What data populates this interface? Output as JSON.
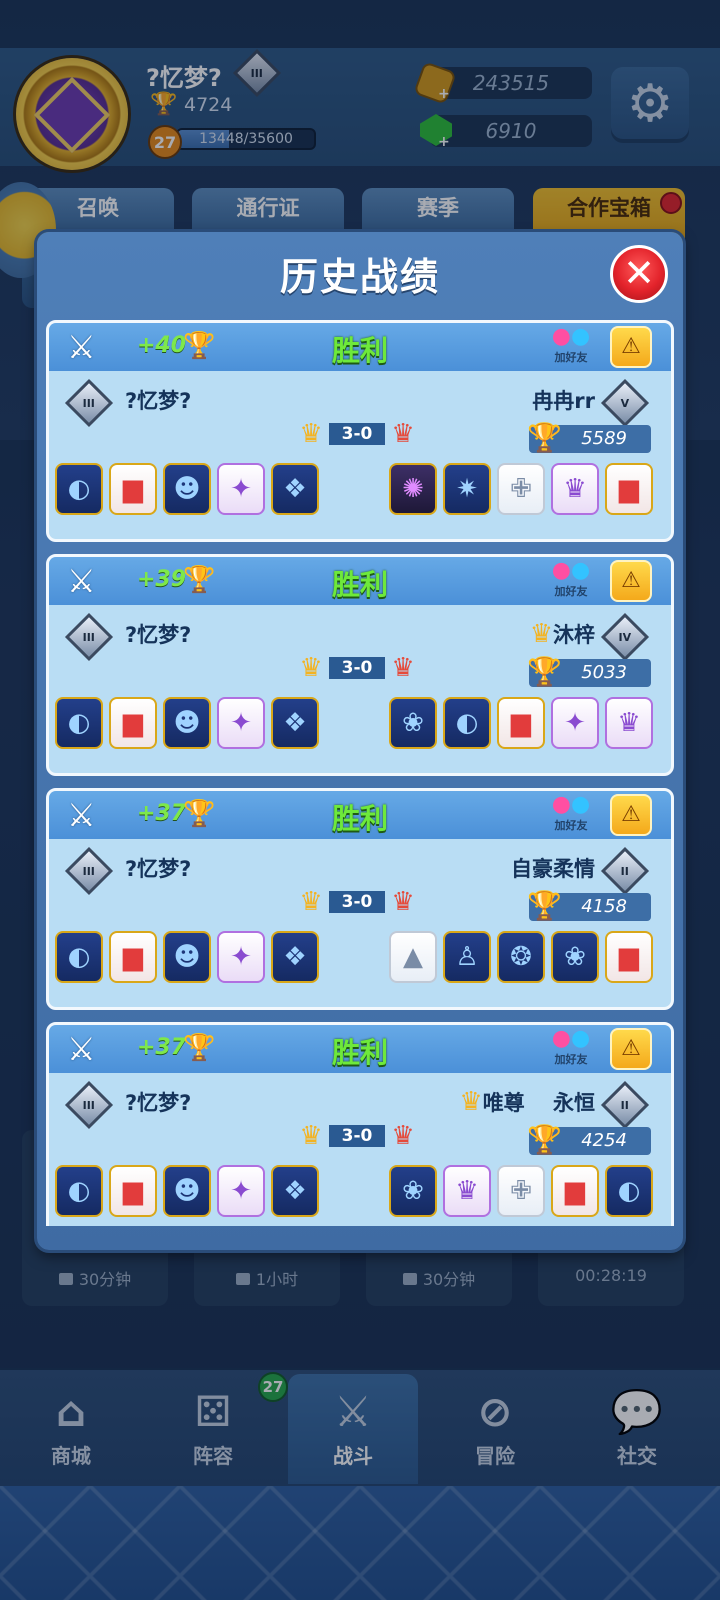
{
  "header": {
    "username": "?忆梦?",
    "rank_label": "III",
    "trophies": "4724",
    "level": "27",
    "xp_text": "13448/35600",
    "xp_fraction": 0.378,
    "gold": "243515",
    "gems": "6910",
    "settings_icon": "gear-icon"
  },
  "tabs": [
    "召唤",
    "通行证",
    "赛季",
    "合作宝箱"
  ],
  "timers": [
    "30分钟",
    "1小时",
    "30分钟",
    "00:28:19"
  ],
  "modal": {
    "title": "历史战绩",
    "close_glyph": "✕"
  },
  "matches": [
    {
      "delta": "+40",
      "result": "胜利",
      "add_friend": "加好友",
      "self_name": "?忆梦?",
      "self_rank": "III",
      "opp_name": "冉冉rr",
      "opp_rank": "V",
      "opp_crown": "",
      "score": "3-0",
      "opp_trophies": "5589",
      "self_dice": [
        "c-blue",
        "c-red",
        "c-blue",
        "c-purple",
        "c-blue"
      ],
      "self_glyphs": [
        "◐",
        "▆",
        "☻",
        "✦",
        "❖"
      ],
      "opp_dice": [
        "c-dark",
        "c-blue",
        "c-white",
        "c-purple",
        "c-red"
      ],
      "opp_glyphs": [
        "✺",
        "✷",
        "✙",
        "♛",
        "▆"
      ]
    },
    {
      "delta": "+39",
      "result": "胜利",
      "add_friend": "加好友",
      "self_name": "?忆梦?",
      "self_rank": "III",
      "opp_name": "沐梓",
      "opp_rank": "IV",
      "opp_crown": "♛",
      "score": "3-0",
      "opp_trophies": "5033",
      "self_dice": [
        "c-blue",
        "c-red",
        "c-blue",
        "c-purple",
        "c-blue"
      ],
      "self_glyphs": [
        "◐",
        "▆",
        "☻",
        "✦",
        "❖"
      ],
      "opp_dice": [
        "c-blue",
        "c-blue",
        "c-red",
        "c-purple",
        "c-purple"
      ],
      "opp_glyphs": [
        "❀",
        "◐",
        "▆",
        "✦",
        "♛"
      ]
    },
    {
      "delta": "+37",
      "result": "胜利",
      "add_friend": "加好友",
      "self_name": "?忆梦?",
      "self_rank": "III",
      "opp_name": "自豪柔情",
      "opp_rank": "II",
      "opp_crown": "",
      "score": "3-0",
      "opp_trophies": "4158",
      "self_dice": [
        "c-blue",
        "c-red",
        "c-blue",
        "c-purple",
        "c-blue"
      ],
      "self_glyphs": [
        "◐",
        "▆",
        "☻",
        "✦",
        "❖"
      ],
      "opp_dice": [
        "c-white",
        "c-blue",
        "c-blue",
        "c-blue",
        "c-red"
      ],
      "opp_glyphs": [
        "▲",
        "♙",
        "❂",
        "❀",
        "▆"
      ]
    },
    {
      "delta": "+37",
      "result": "胜利",
      "add_friend": "加好友",
      "self_name": "?忆梦?",
      "self_rank": "III",
      "opp_name": "唯尊　 永恒",
      "opp_rank": "II",
      "opp_crown": "♛",
      "score": "3-0",
      "opp_trophies": "4254",
      "self_dice": [
        "c-blue",
        "c-red",
        "c-blue",
        "c-purple",
        "c-blue"
      ],
      "self_glyphs": [
        "◐",
        "▆",
        "☻",
        "✦",
        "❖"
      ],
      "opp_dice": [
        "c-blue",
        "c-purple",
        "c-white",
        "c-red",
        "c-blue"
      ],
      "opp_glyphs": [
        "❀",
        "♛",
        "✙",
        "▆",
        "◐"
      ]
    }
  ],
  "nav": {
    "items": [
      {
        "label": "商城",
        "icon": "store-icon",
        "glyph": "⌂"
      },
      {
        "label": "阵容",
        "icon": "dice-icon",
        "glyph": "⚄"
      },
      {
        "label": "战斗",
        "icon": "crossed-swords-icon",
        "glyph": "⚔"
      },
      {
        "label": "冒险",
        "icon": "adventure-icon",
        "glyph": "⊘"
      },
      {
        "label": "社交",
        "icon": "chat-icon",
        "glyph": "💬"
      }
    ],
    "badge": "27",
    "active": "战斗"
  }
}
